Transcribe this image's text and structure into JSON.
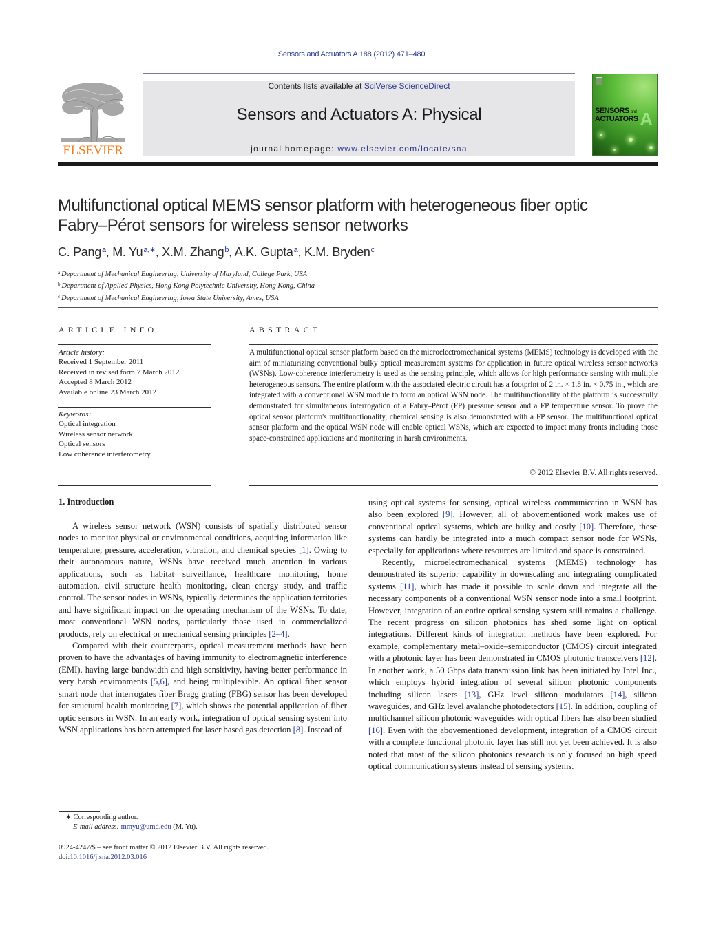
{
  "header": {
    "citation": "Sensors and Actuators A 188 (2012) 471–480",
    "contents_prefix": "Contents lists available at ",
    "contents_link": "SciVerse ScienceDirect",
    "journal_title": "Sensors and Actuators A: Physical",
    "homepage_prefix": "journal homepage: ",
    "homepage_link": "www.elsevier.com/locate/sna",
    "publisher_logo_text": "ELSEVIER",
    "cover": {
      "line1": "SENSORS",
      "line1_small": "and",
      "line2": "ACTUATORS",
      "letter": "A"
    },
    "colors": {
      "link": "#2b3a8f",
      "elsevier_orange": "#f07c1a",
      "masthead_bg": "#e6e6e8"
    }
  },
  "article": {
    "title_line1": "Multifunctional optical MEMS sensor platform with heterogeneous fiber optic",
    "title_line2": "Fabry–Pérot sensors for wireless sensor networks",
    "authors": [
      {
        "name": "C. Pang",
        "sup": "a",
        "sep": ", "
      },
      {
        "name": "M. Yu",
        "sup": "a,∗",
        "sep": ", "
      },
      {
        "name": "X.M. Zhang",
        "sup": "b",
        "sep": ", "
      },
      {
        "name": "A.K. Gupta",
        "sup": "a",
        "sep": ", "
      },
      {
        "name": "K.M. Bryden",
        "sup": "c",
        "sep": ""
      }
    ],
    "affiliations": [
      {
        "mark": "a",
        "text": "Department of Mechanical Engineering, University of Maryland, College Park, USA"
      },
      {
        "mark": "b",
        "text": "Department of Applied Physics, Hong Kong Polytechnic University, Hong Kong, China"
      },
      {
        "mark": "c",
        "text": "Department of Mechanical Engineering, Iowa State University, Ames, USA"
      }
    ]
  },
  "article_info": {
    "heading": "ARTICLE INFO",
    "history_label": "Article history:",
    "history": [
      "Received 1 September 2011",
      "Received in revised form 7 March 2012",
      "Accepted 8 March 2012",
      "Available online 23 March 2012"
    ],
    "keywords_label": "Keywords:",
    "keywords": [
      "Optical integration",
      "Wireless sensor network",
      "Optical sensors",
      "Low coherence interferometry"
    ]
  },
  "abstract": {
    "heading": "ABSTRACT",
    "text": "A multifunctional optical sensor platform based on the microelectromechanical systems (MEMS) tech­nology is developed with the aim of miniaturizing conventional bulky optical measurement systems for application in future optical wireless sensor networks (WSNs). Low-coherence interferometry is used as the sensing principle, which allows for high performance sensing with multiple heterogeneous sensors. The entire platform with the associated electric circuit has a footprint of 2 in. × 1.8 in. × 0.75 in., which are integrated with a conventional WSN module to form an optical WSN node. The multifunctionality of the platform is successfully demonstrated for simultaneous interrogation of a Fabry–Pérot (FP) pressure sensor and a FP temperature sensor. To prove the optical sensor platform's multifunctionality, chemi­cal sensing is also demonstrated with a FP sensor. The multifunctional optical sensor platform and the optical WSN node will enable optical WSNs, which are expected to impact many fronts including those space-constrained applications and monitoring in harsh environments.",
    "copyright": "© 2012 Elsevier B.V. All rights reserved."
  },
  "body": {
    "section_heading": "1.  Introduction",
    "left_paragraphs": [
      [
        {
          "t": "A wireless sensor network (WSN) consists of spatially dis­tributed sensor nodes to monitor physical or environmental conditions, acquiring information like temperature, pressure, acceleration, vibration, and chemical species "
        },
        {
          "ref": "[1]"
        },
        {
          "t": ". Owing to their autonomous nature, WSNs have received much attention in various applications, such as habitat surveillance, healthcare monitoring, home automation, civil structure health monitoring, clean energy study, and traffic control. The sensor nodes in WSNs, typically determines the application territories and have significant impact on the operating mechanism of the WSNs. To date, most con­ventional WSN nodes, particularly those used in commercialized products, rely on electrical or mechanical sensing principles "
        },
        {
          "ref": "[2–4]"
        },
        {
          "t": "."
        }
      ],
      [
        {
          "t": "Compared with their counterparts, optical measurement meth­ods have been proven to have the advantages of having immunity to electromagnetic interference (EMI), having large bandwidth and high sensitivity, having better performance in very harsh environ­ments "
        },
        {
          "ref": "[5,6]"
        },
        {
          "t": ", and being multiplexible. An optical fiber sensor smart node that interrogates fiber Bragg grating (FBG) sensor has been developed for structural health monitoring "
        },
        {
          "ref": "[7]"
        },
        {
          "t": ", which shows the potential application of fiber optic sensors in WSN. In an early work, integration of optical sensing system into WSN applications has been attempted for laser based gas detection "
        },
        {
          "ref": "[8]"
        },
        {
          "t": ". Instead of"
        }
      ]
    ],
    "right_paragraphs": [
      [
        {
          "t": "using optical systems for sensing, optical wireless communication in WSN has also been explored "
        },
        {
          "ref": "[9]"
        },
        {
          "t": ". However, all of abovemen­tioned work makes use of conventional optical systems, which are bulky and costly "
        },
        {
          "ref": "[10]"
        },
        {
          "t": ". Therefore, these systems can hardly be inte­grated into a much compact sensor node for WSNs, especially for applications where resources are limited and space is constrained."
        }
      ],
      [
        {
          "t": "Recently, microelectromechanical systems (MEMS) technology has demonstrated its superior capability in downscaling and inte­grating complicated systems "
        },
        {
          "ref": "[11]"
        },
        {
          "t": ", which has made it possible to scale down and integrate all the necessary components of a conventional WSN sensor node into a small footprint. How­ever, integration of an entire optical sensing system still remains a challenge. The recent progress on silicon photonics has shed some light on optical integrations. Different kinds of integra­tion methods have been explored. For example, complementary metal–oxide–semiconductor (CMOS) circuit integrated with a pho­tonic layer has been demonstrated in CMOS photonic transceivers "
        },
        {
          "ref": "[12]"
        },
        {
          "t": ". In another work, a 50 Gbps data transmission link has been initiated by Intel Inc., which employs hybrid integration of sev­eral silicon photonic components including silicon lasers "
        },
        {
          "ref": "[13]"
        },
        {
          "t": ", GHz level silicon modulators "
        },
        {
          "ref": "[14]"
        },
        {
          "t": ", silicon waveguides, and GHz level avalanche photodetectors "
        },
        {
          "ref": "[15]"
        },
        {
          "t": ". In addition, coupling of multichan­nel silicon photonic waveguides with optical fibers has also been studied "
        },
        {
          "ref": "[16]"
        },
        {
          "t": ". Even with the abovementioned development, integra­tion of a CMOS circuit with a complete functional photonic layer has still not yet been achieved. It is also noted that most of the silicon photonics research is only focused on high speed optical communication systems instead of sensing systems."
        }
      ]
    ]
  },
  "footnotes": {
    "corresponding_mark": "∗",
    "corresponding_text": " Corresponding author.",
    "email_label": "E-mail address:",
    "email": "mmyu@umd.edu",
    "email_suffix": " (M. Yu).",
    "front_matter": "0924-4247/$ – see front matter © 2012 Elsevier B.V. All rights reserved.",
    "doi_prefix": "doi:",
    "doi": "10.1016/j.sna.2012.03.016"
  }
}
